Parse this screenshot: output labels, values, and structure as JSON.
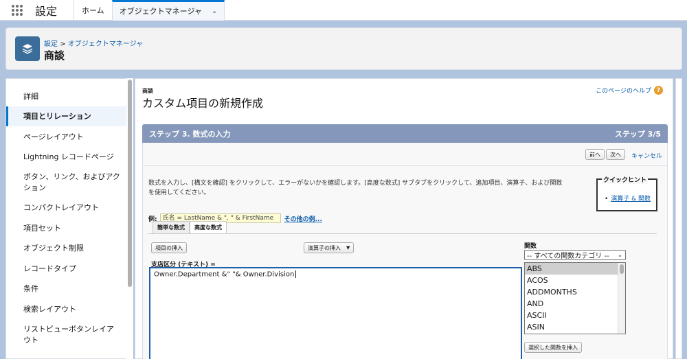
{
  "topbar": {
    "app_name": "設定",
    "nav_home": "ホーム",
    "nav_tab": "オブジェクトマネージャ"
  },
  "header": {
    "crumb_root": "設定",
    "crumb_sep": ">",
    "crumb_child": "オブジェクトマネージャ",
    "title": "商談"
  },
  "sidebar": {
    "items": [
      {
        "label": "詳細"
      },
      {
        "label": "項目とリレーション"
      },
      {
        "label": "ページレイアウト"
      },
      {
        "label": "Lightning レコードページ"
      },
      {
        "label": "ボタン、リンク、およびアク"
      },
      {
        "label": "ション"
      },
      {
        "label": "コンパクトレイアウト"
      },
      {
        "label": "項目セット"
      },
      {
        "label": "オブジェクト制限"
      },
      {
        "label": "レコードタイプ"
      },
      {
        "label": "条件"
      },
      {
        "label": "検索レイアウト"
      },
      {
        "label": "リストビューボタンレイア"
      },
      {
        "label": "ウト"
      }
    ]
  },
  "main": {
    "subtitle": "商談",
    "title": "カスタム項目の新規作成",
    "help_link": "このページのヘルプ",
    "help_icon": "?",
    "step_left": "ステップ 3. 数式の入力",
    "step_right": "ステップ 3/5",
    "prev_btn": "前へ",
    "next_btn": "次へ",
    "cancel_link": "キャンセル",
    "desc_line1": "数式を入力し、[構文を確認] をクリックして、エラーがないかを確認します。[高度な数式] サブタブをクリックして、追加項目、演算子、および関数",
    "desc_line2": "を使用してください。",
    "quick_hint_title": "クイックヒント",
    "quick_hint_item": "演算子 & 関数",
    "example_label": "例:",
    "example_code": "氏名 = LastName & \", \" & FirstName",
    "example_more": "その他の例...",
    "tab_simple": "簡単な数式",
    "tab_advanced": "高度な数式",
    "insert_field_btn": "項目の挿入",
    "insert_operator_btn": "演算子の挿入",
    "field_label": "支店区分 (テキスト) =",
    "formula_value": "Owner.Department &\" \"& Owner.Division",
    "functions_label": "関数",
    "func_category": "-- すべての関数カテゴリ --",
    "functions": [
      "ABS",
      "ACOS",
      "ADDMONTHS",
      "AND",
      "ASCII",
      "ASIN"
    ],
    "insert_func_btn": "選択した関数を挿入"
  },
  "colors": {
    "accent": "#0176d3",
    "step_bar": "#8597ba",
    "background": "#b0c4df"
  }
}
